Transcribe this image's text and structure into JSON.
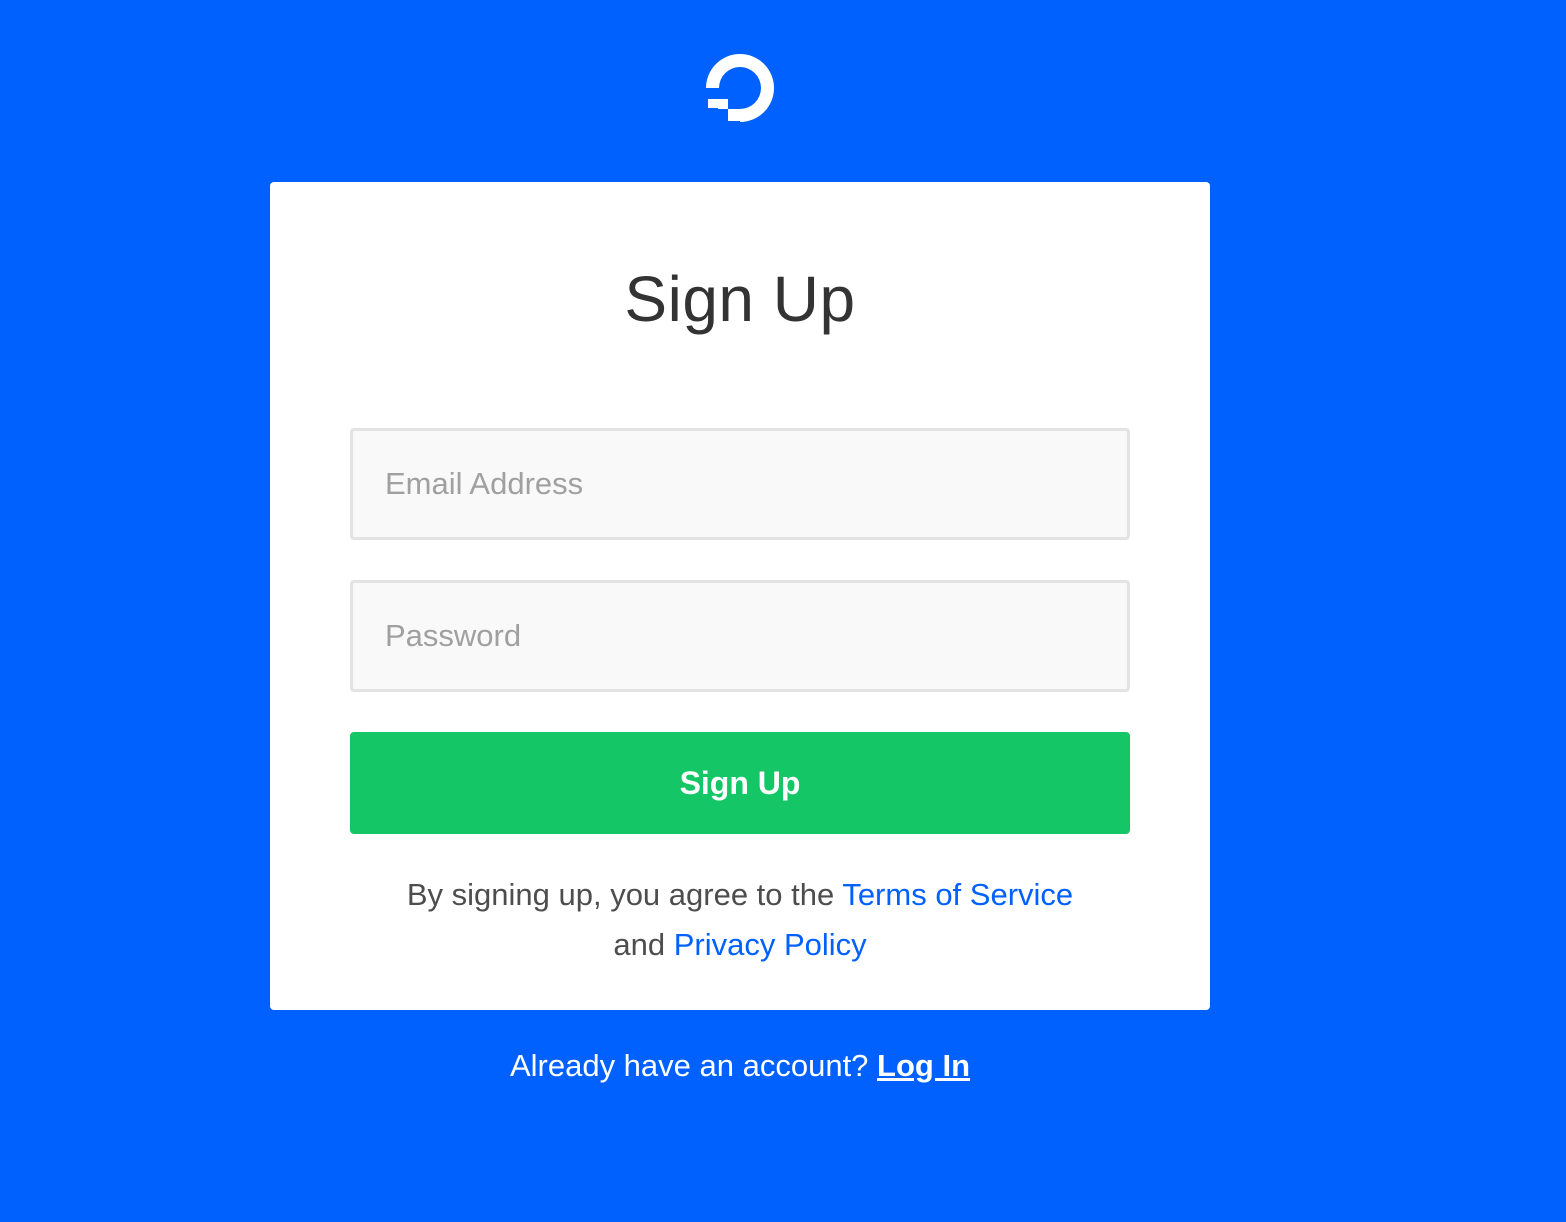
{
  "brand": {
    "logo_icon": "digitalocean-logo-icon",
    "background_color": "#0061ff",
    "primary_color": "#15c667",
    "link_color": "#0061ff"
  },
  "form": {
    "title": "Sign Up",
    "email": {
      "value": "",
      "placeholder": "Email Address"
    },
    "password": {
      "value": "",
      "placeholder": "Password"
    },
    "submit_label": "Sign Up",
    "terms_prefix": "By signing up, you agree to the",
    "terms_link": "Terms of Service",
    "terms_and": "and",
    "privacy_link": "Privacy Policy"
  },
  "footer": {
    "prompt": "Already have an account?",
    "login_link": "Log In"
  }
}
